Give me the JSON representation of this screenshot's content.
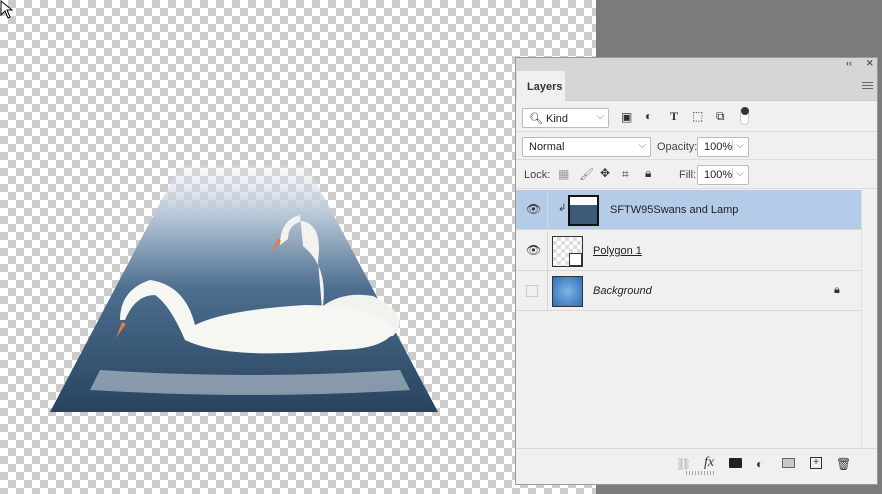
{
  "panel": {
    "tab": "Layers",
    "collapse_label": "‹‹",
    "close_label": "✕"
  },
  "filter": {
    "kind": "Kind",
    "icons": [
      "image-filter-icon",
      "adjustment-filter-icon",
      "type-filter-icon",
      "shape-filter-icon",
      "smart-object-filter-icon"
    ]
  },
  "blend": {
    "mode": "Normal",
    "opacity_label": "Opacity:",
    "opacity": "100%"
  },
  "lock": {
    "label": "Lock:",
    "fill_label": "Fill:",
    "fill": "100%"
  },
  "layers": [
    {
      "name": "SFTW95Swans and Lamp",
      "visible": true,
      "selected": true
    },
    {
      "name": "Polygon 1",
      "visible": true,
      "selected": false
    },
    {
      "name": "Background",
      "visible": false,
      "selected": false,
      "locked": true
    }
  ],
  "footer": {
    "fx": "fx"
  },
  "colors": {
    "selected": "#b5cce9",
    "canvas_bg": "#7b7b7b"
  }
}
